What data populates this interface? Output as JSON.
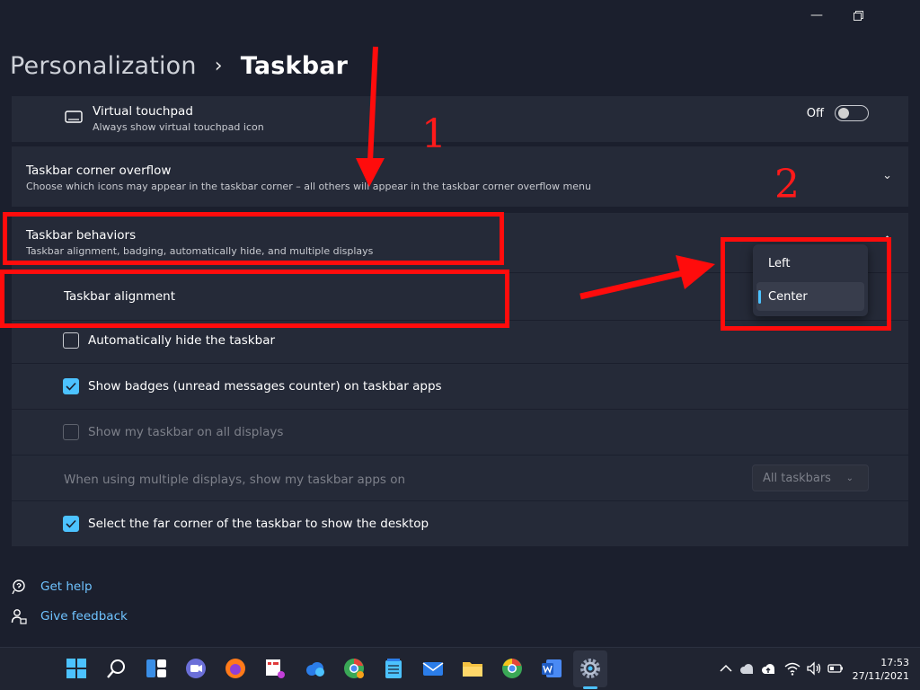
{
  "window": {
    "min_icon": "minimize-icon",
    "max_icon": "restore-icon"
  },
  "breadcrumb": {
    "parent": "Personalization",
    "separator": "›",
    "current": "Taskbar"
  },
  "virtual_touchpad": {
    "title": "Virtual touchpad",
    "desc": "Always show virtual touchpad icon",
    "toggle_label": "Off",
    "toggle_on": false
  },
  "corner_overflow": {
    "title": "Taskbar corner overflow",
    "desc": "Choose which icons may appear in the taskbar corner – all others will appear in the taskbar corner overflow menu"
  },
  "behaviors": {
    "title": "Taskbar behaviors",
    "desc": "Taskbar alignment, badging, automatically hide, and multiple displays",
    "alignment_label": "Taskbar alignment",
    "alignment_options": [
      "Left",
      "Center"
    ],
    "alignment_selected": "Center",
    "auto_hide": {
      "label": "Automatically hide the taskbar",
      "checked": false
    },
    "badges": {
      "label": "Show badges (unread messages counter) on taskbar apps",
      "checked": true
    },
    "all_displays": {
      "label": "Show my taskbar on all displays",
      "checked": false,
      "disabled": true
    },
    "multi_display": {
      "label": "When using multiple displays, show my taskbar apps on",
      "value": "All taskbars"
    },
    "far_corner": {
      "label": "Select the far corner of the taskbar to show the desktop",
      "checked": true
    }
  },
  "links": {
    "help": "Get help",
    "feedback": "Give feedback"
  },
  "annotations": {
    "one": "1",
    "two": "2"
  },
  "clock": {
    "time": "17:53",
    "date": "27/11/2021"
  },
  "colors": {
    "accent": "#4cc2ff",
    "annotation": "#ff0c0c",
    "background": "#1b1f2d",
    "card": "#252a38"
  }
}
